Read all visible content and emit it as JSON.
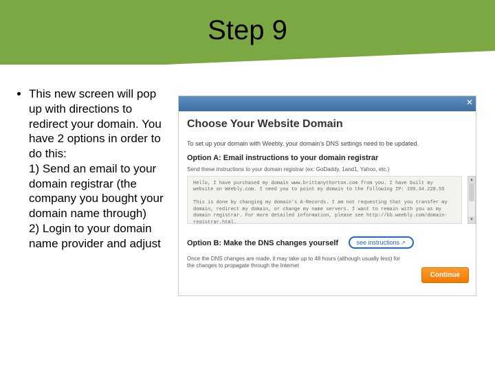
{
  "title": "Step 9",
  "bullet_text": "This new screen will pop up with directions to redirect your domain. You have 2 options in order to do this:\n1) Send an email to your domain registrar (the company you bought your domain name through)\n2) Login to your domain name provider and adjust",
  "modal": {
    "heading": "Choose Your Website Domain",
    "intro": "To set up your domain with Weebly, your domain's DNS settings need to be updated.",
    "optionA_title": "Option A: Email instructions to your domain registrar",
    "optionA_sub": "Send these instructions to your domain registrar (ex: GoDaddy, 1and1, Yahoo, etc.)",
    "email_body": "Hello, I have purchased my domain www.brittanythorton.com from you.  I have built my website on Weebly.com.  I need you to point my domain to the following IP: 199.34.228.55\n\nThis is done by changing my domain's A-Records.  I am not requesting that you transfer my domain, redirect my domain, or change my name servers.  I want to remain with you as my domain registrar.  For more detailed information, please see http://kb.weebly.com/domain-registrar.html.",
    "optionB_title": "Option B: Make the DNS changes yourself",
    "see_instructions": "see instructions",
    "footer_note": "Once the DNS changes are made, it may take up to 48 hours (although usually less) for the changes to propagate through the Internet",
    "continue": "Continue",
    "close": "✕"
  },
  "icons": {
    "external": "↗",
    "up": "▴",
    "down": "▾"
  }
}
